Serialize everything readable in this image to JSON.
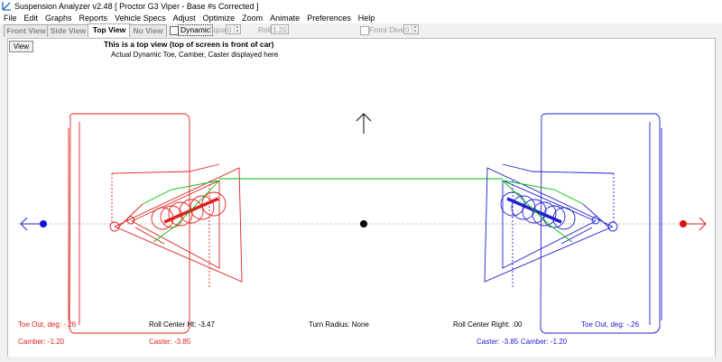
{
  "window": {
    "title": "Suspension Analyzer v2.48   [ Proctor G3 Viper - Base #s Corrected ]"
  },
  "menu": [
    "File",
    "Edit",
    "Graphs",
    "Reports",
    "Vehicle Specs",
    "Adjust",
    "Optimize",
    "Zoom",
    "Animate",
    "Preferences",
    "Help"
  ],
  "tabs": [
    "Front View",
    "Side View",
    "Top View",
    "No View"
  ],
  "active_tab": "Top View",
  "toolbar": {
    "dynamic_label": "Dynamic",
    "squat_label": "Squat",
    "squat_value": "0",
    "roll_label": "Roll",
    "roll_value": "1.20",
    "front_dive_label": "Front Dive",
    "front_dive_value": "0"
  },
  "view_button": "View",
  "info": {
    "line1": "This is a top view (top of screen is front of car)",
    "line2": "Actual Dynamic Toe, Camber, Caster displayed here"
  },
  "readouts": {
    "left_toe": "Toe Out, deg: -.26",
    "left_camber": "Camber: -1.20",
    "left_caster": "Caster: -3.85",
    "roll_center_ht": "Roll Center Ht: -3.47",
    "turn_radius": "Turn Radius: None",
    "roll_center_right": "Roll Center Right: .00",
    "right_toe": "Toe Out, deg: -.26",
    "right_caster": "Caster: -3.85",
    "right_camber": "Camber: -1.20"
  },
  "colors": {
    "left": "#e02020",
    "right": "#2020d0",
    "link": "#00c000",
    "centerline": "#bbbbbb"
  }
}
